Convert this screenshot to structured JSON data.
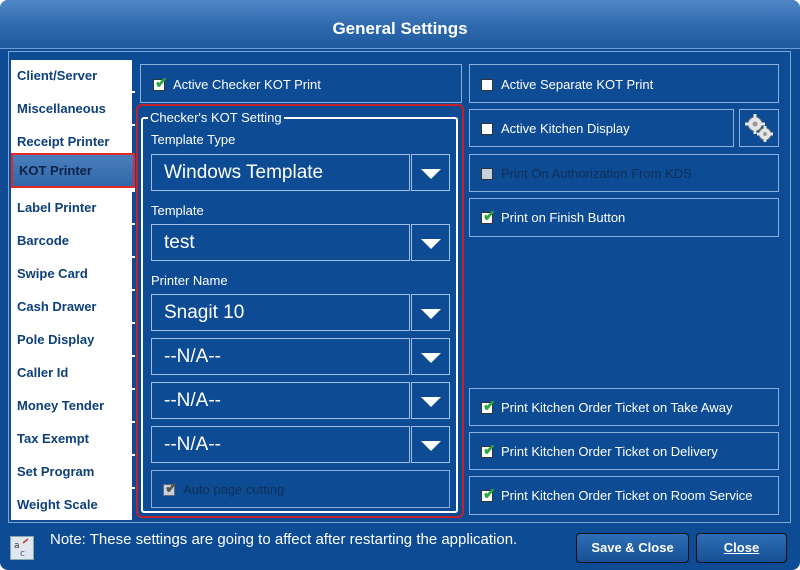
{
  "window": {
    "title": "General Settings"
  },
  "sidebar": {
    "items": [
      {
        "label": "Client/Server"
      },
      {
        "label": "Miscellaneous"
      },
      {
        "label": "Receipt Printer"
      },
      {
        "label": "KOT Printer",
        "active": true
      },
      {
        "label": "Label Printer"
      },
      {
        "label": "Barcode"
      },
      {
        "label": "Swipe Card"
      },
      {
        "label": "Cash Drawer"
      },
      {
        "label": "Pole Display"
      },
      {
        "label": "Caller Id"
      },
      {
        "label": "Money Tender"
      },
      {
        "label": "Tax Exempt"
      },
      {
        "label": "Set Program"
      },
      {
        "label": "Weight Scale"
      }
    ]
  },
  "left_panel": {
    "active_checker": {
      "label": "Active Checker KOT Print",
      "checked": true
    },
    "group_title": "Checker's KOT Setting",
    "template_type_label": "Template Type",
    "template_type_value": "Windows Template",
    "template_label": "Template",
    "template_value": "test",
    "printer_name_label": "Printer Name",
    "printer_name_value": "Snagit 10",
    "extra_printers": [
      "--N/A--",
      "--N/A--",
      "--N/A--"
    ],
    "auto_cut": {
      "label": "Auto page cutting",
      "checked": true,
      "disabled": true
    }
  },
  "right_panel": {
    "active_separate": {
      "label": "Active Separate KOT Print",
      "checked": false
    },
    "active_kitchen_display": {
      "label": "Active Kitchen Display",
      "checked": false
    },
    "print_on_authorization": {
      "label": "Print On Authorization From KDS",
      "checked": false,
      "disabled": true
    },
    "print_on_finish": {
      "label": "Print on Finish Button",
      "checked": true
    },
    "print_take_away": {
      "label": "Print Kitchen Order Ticket on Take Away",
      "checked": true
    },
    "print_delivery": {
      "label": "Print Kitchen Order Ticket on Delivery",
      "checked": true
    },
    "print_room_service": {
      "label": "Print Kitchen Order Ticket on Room Service",
      "checked": true
    }
  },
  "footer": {
    "note": "Note: These settings are going to affect after restarting the application.",
    "save_close": "Save & Close",
    "close": "Close"
  },
  "colors": {
    "background": "#0d4c94",
    "highlight": "#c4222a",
    "check": "#2fa83a"
  }
}
